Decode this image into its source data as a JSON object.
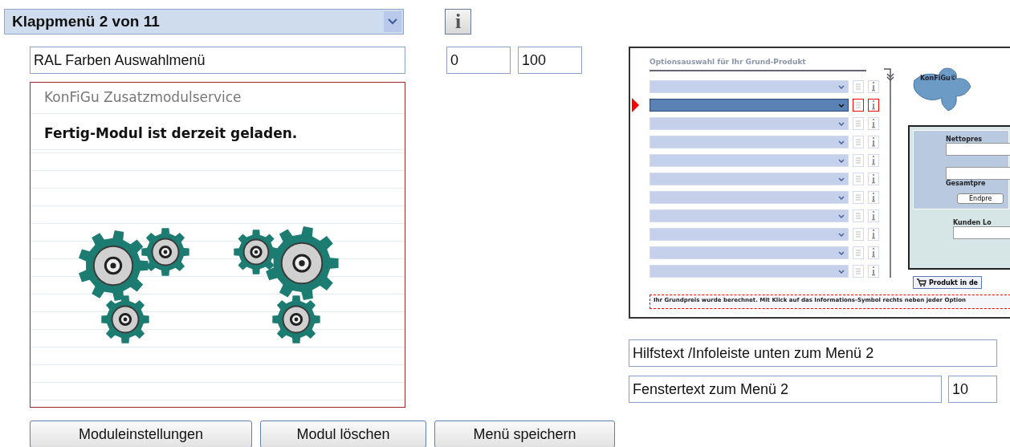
{
  "menu_select": {
    "value": "Klappmenü 2 von 11"
  },
  "info_button": {
    "label": "i"
  },
  "menu_name": {
    "value": "RAL Farben Auswahlmenü"
  },
  "range_min": {
    "value": "0"
  },
  "range_max": {
    "value": "100"
  },
  "module_panel": {
    "title": "KonFiGu Zusatzmodulservice",
    "status": "Fertig-Modul ist derzeit geladen."
  },
  "buttons": [
    "Moduleinstellungen",
    "Modul löschen",
    "Menü speichern"
  ],
  "preview": {
    "title": "Optionsauswahl für Ihr Grund-Produkt",
    "logo": "KonFiGu©",
    "options": [
      {
        "selected": false
      },
      {
        "selected": true
      },
      {
        "selected": false
      },
      {
        "selected": false
      },
      {
        "selected": false
      },
      {
        "selected": false
      },
      {
        "selected": false
      },
      {
        "selected": false
      },
      {
        "selected": false
      },
      {
        "selected": false
      },
      {
        "selected": false
      }
    ],
    "net_price_label": "Nettopres",
    "total_price_label": "Gesamtpre",
    "final_price_button": "Endpre",
    "customer_label": "Kunden Lo",
    "cart_button": "Produkt in de",
    "status_text": "Ihr Grundpreis wurde berechnet. Mit Klick auf das Informations-Symbol rechts neben jeder Option"
  },
  "help_text": {
    "value": "Hilfstext /Infoleiste unten zum Menü 2"
  },
  "window_text": {
    "value": "Fenstertext zum Menü 2"
  },
  "window_size": {
    "value": "10"
  }
}
